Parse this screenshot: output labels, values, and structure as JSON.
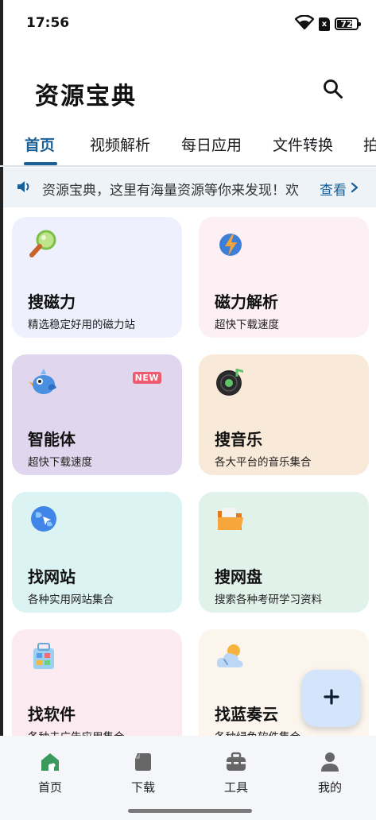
{
  "status_bar": {
    "time": "17:56",
    "battery": "72",
    "sim_badge": "x"
  },
  "header": {
    "title": "资源宝典",
    "search_icon": "search-icon"
  },
  "tabs": [
    {
      "label": "首页",
      "active": true
    },
    {
      "label": "视频解析",
      "active": false
    },
    {
      "label": "每日应用",
      "active": false
    },
    {
      "label": "文件转换",
      "active": false
    },
    {
      "label": "拍",
      "active": false
    }
  ],
  "notice": {
    "icon": "speaker-icon",
    "text": "资源宝典，这里有海量资源等你来发现！欢",
    "more_label": "查看"
  },
  "cards": [
    {
      "title": "搜磁力",
      "subtitle": "精选稳定好用的磁力站",
      "icon": "magnifier-icon",
      "bg": "#eef0fd",
      "badge": ""
    },
    {
      "title": "磁力解析",
      "subtitle": "超快下载速度",
      "icon": "lightning-icon",
      "bg": "#fcf0f4",
      "badge": ""
    },
    {
      "title": "智能体",
      "subtitle": "超快下载速度",
      "icon": "bird-icon",
      "bg": "#e0d7ee",
      "badge": "NEW"
    },
    {
      "title": "搜音乐",
      "subtitle": "各大平台的音乐集合",
      "icon": "music-disc-icon",
      "bg": "#f9e9d9",
      "badge": ""
    },
    {
      "title": "找网站",
      "subtitle": "各种实用网站集合",
      "icon": "globe-icon",
      "bg": "#dcf3f4",
      "badge": ""
    },
    {
      "title": "搜网盘",
      "subtitle": "搜索各种考研学习资料",
      "icon": "folder-icon",
      "bg": "#e0f2ea",
      "badge": ""
    },
    {
      "title": "找软件",
      "subtitle": "各种去广告应用集合",
      "icon": "software-icon",
      "bg": "#fbeaf0",
      "badge": ""
    },
    {
      "title": "找蓝奏云",
      "subtitle": "各种绿色软件集合",
      "icon": "cloud-icon",
      "bg": "#fbf5ee",
      "badge": ""
    }
  ],
  "fab": {
    "icon": "plus-icon",
    "label": "+"
  },
  "bottom_nav": [
    {
      "label": "首页",
      "icon": "home-icon",
      "active": true
    },
    {
      "label": "下载",
      "icon": "download-icon",
      "active": false
    },
    {
      "label": "工具",
      "icon": "toolbox-icon",
      "active": false
    },
    {
      "label": "我的",
      "icon": "person-icon",
      "active": false
    }
  ],
  "colors": {
    "accent": "#1a5f96",
    "home_green": "#3a9a5b"
  }
}
